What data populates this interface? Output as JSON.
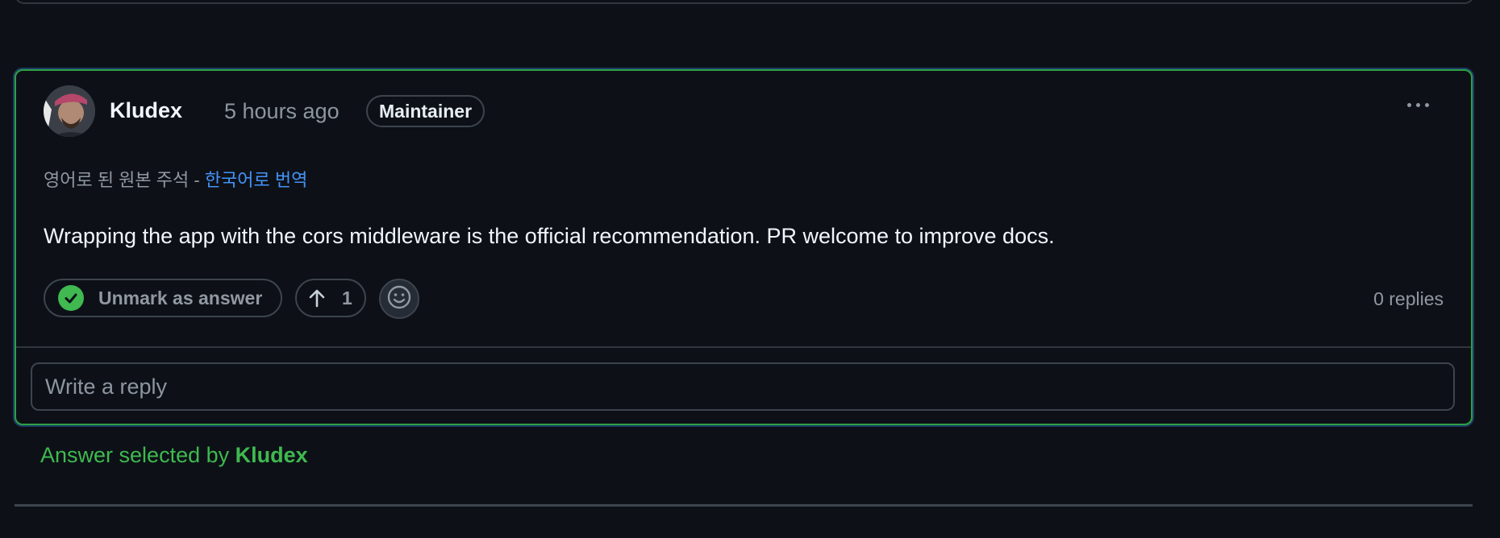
{
  "comment": {
    "author": "Kludex",
    "time": "5 hours ago",
    "role_badge": "Maintainer",
    "translation_prefix": "영어로 된 원본 주석 - ",
    "translation_link": "한국어로 번역",
    "body": "Wrapping the app with the cors middleware is the official recommendation. PR welcome to improve docs.",
    "unmark_label": "Unmark as answer",
    "upvote_count": "1",
    "replies": "0 replies",
    "reply_placeholder": "Write a reply",
    "icons": [
      "avatar",
      "kebab-menu-icon",
      "check-circle-icon",
      "arrow-up-icon",
      "smiley-icon"
    ]
  },
  "answer_selection": {
    "prefix": "Answer selected by ",
    "user": "Kludex"
  },
  "colors": {
    "background": "#0d1117",
    "answer_border": "#2ea043",
    "success_text": "#3fb950",
    "link": "#4493f8",
    "muted": "#9198a1"
  }
}
